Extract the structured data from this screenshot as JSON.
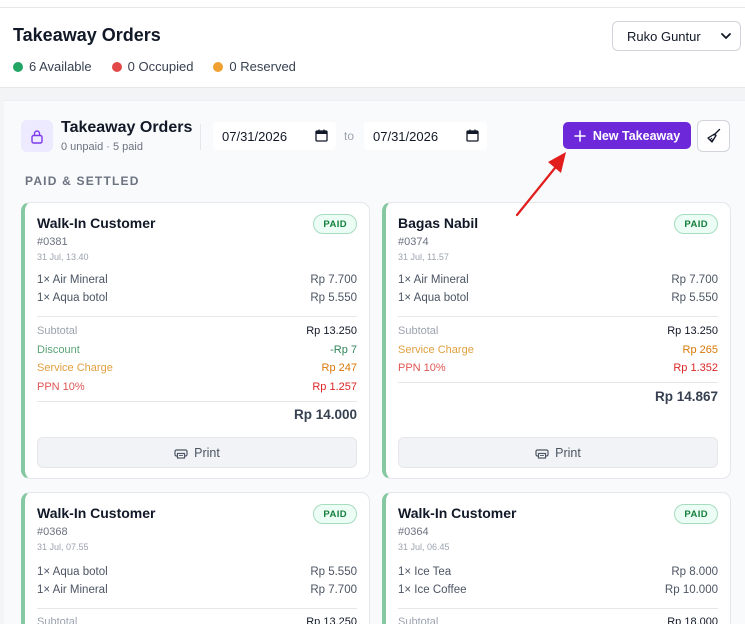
{
  "header": {
    "title": "Takeaway Orders",
    "legend": [
      {
        "label": "6 Available",
        "color": "#22a565"
      },
      {
        "label": "0 Occupied",
        "color": "#e34848"
      },
      {
        "label": "0 Reserved",
        "color": "#f0a030"
      }
    ],
    "branch": {
      "selected": "Ruko Guntur",
      "icon": "chevron-down-icon"
    }
  },
  "panel": {
    "title": "Takeaway Orders",
    "subtitle": "0 unpaid · 5 paid",
    "date_from": "07/31/2026",
    "to_label": "to",
    "date_to": "07/31/2026",
    "new_button": "New Takeaway",
    "section_label": "PAID & SETTLED",
    "accent_color": "#6d28d9"
  },
  "orders": [
    {
      "customer": "Walk-In Customer",
      "number": "#0381",
      "time": "31 Jul, 13.40",
      "status": "PAID",
      "items": [
        {
          "name": "1× Air Mineral",
          "price": "Rp 7.700"
        },
        {
          "name": "1× Aqua botol",
          "price": "Rp 5.550"
        }
      ],
      "subtotal": {
        "label": "Subtotal",
        "value": "Rp 13.250"
      },
      "discount": {
        "label": "Discount",
        "value": "-Rp 7"
      },
      "service": {
        "label": "Service Charge",
        "value": "Rp 247"
      },
      "tax": {
        "label": "PPN 10%",
        "value": "Rp 1.257"
      },
      "total": "Rp 14.000",
      "print_label": "Print"
    },
    {
      "customer": "Bagas Nabil",
      "number": "#0374",
      "time": "31 Jul, 11.57",
      "status": "PAID",
      "items": [
        {
          "name": "1× Air Mineral",
          "price": "Rp 7.700"
        },
        {
          "name": "1× Aqua botol",
          "price": "Rp 5.550"
        }
      ],
      "subtotal": {
        "label": "Subtotal",
        "value": "Rp 13.250"
      },
      "service": {
        "label": "Service Charge",
        "value": "Rp 265"
      },
      "tax": {
        "label": "PPN 10%",
        "value": "Rp 1.352"
      },
      "total": "Rp 14.867",
      "print_label": "Print"
    },
    {
      "customer": "Walk-In Customer",
      "number": "#0368",
      "time": "31 Jul, 07.55",
      "status": "PAID",
      "items": [
        {
          "name": "1× Aqua botol",
          "price": "Rp 5.550"
        },
        {
          "name": "1× Air Mineral",
          "price": "Rp 7.700"
        }
      ],
      "subtotal": {
        "label": "Subtotal",
        "value": "Rp 13.250"
      }
    },
    {
      "customer": "Walk-In Customer",
      "number": "#0364",
      "time": "31 Jul, 06.45",
      "status": "PAID",
      "items": [
        {
          "name": "1× Ice Tea",
          "price": "Rp 8.000"
        },
        {
          "name": "1× Ice Coffee",
          "price": "Rp 10.000"
        }
      ],
      "subtotal": {
        "label": "Subtotal",
        "value": "Rp 18.000"
      }
    }
  ]
}
